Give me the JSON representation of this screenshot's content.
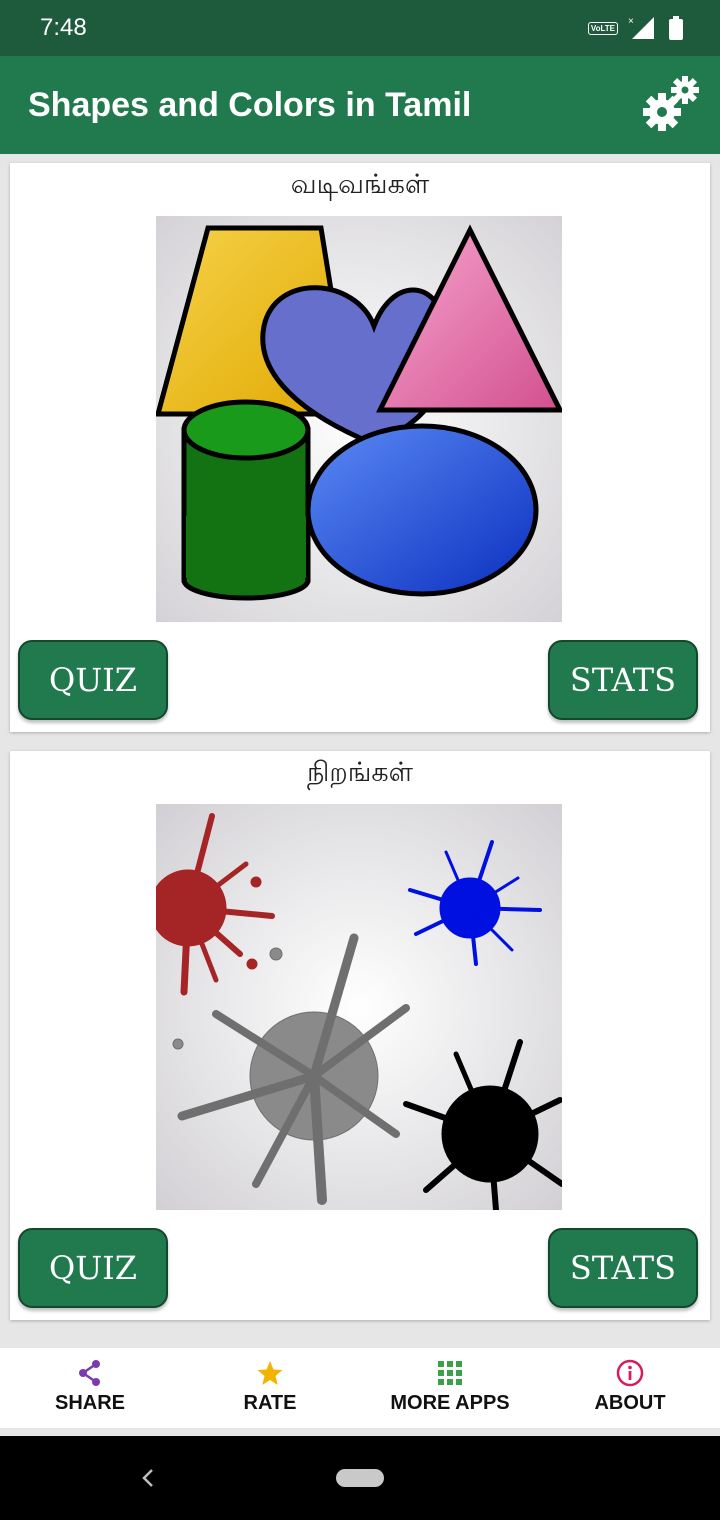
{
  "status_bar": {
    "time": "7:48",
    "volte_label": "VoLTE"
  },
  "app_bar": {
    "title": "Shapes and Colors in Tamil",
    "settings_icon": "gears-icon"
  },
  "cards": [
    {
      "title": "வடிவங்கள்",
      "image": "shapes-illustration",
      "quiz_label": "QUIZ",
      "stats_label": "STATS"
    },
    {
      "title": "நிறங்கள்",
      "image": "paint-splatters-illustration",
      "quiz_label": "QUIZ",
      "stats_label": "STATS"
    }
  ],
  "bottom_nav": [
    {
      "label": "SHARE",
      "icon": "share-icon",
      "color": "#7b3ab0"
    },
    {
      "label": "RATE",
      "icon": "star-icon",
      "color": "#f2b400"
    },
    {
      "label": "MORE APPS",
      "icon": "grid-icon",
      "color": "#3aa04a"
    },
    {
      "label": "ABOUT",
      "icon": "info-icon",
      "color": "#d81b60"
    }
  ],
  "colors": {
    "status_bar": "#1e5a3c",
    "app_bar": "#207a4d",
    "button": "#207a4d",
    "background": "#e6e6e6"
  }
}
